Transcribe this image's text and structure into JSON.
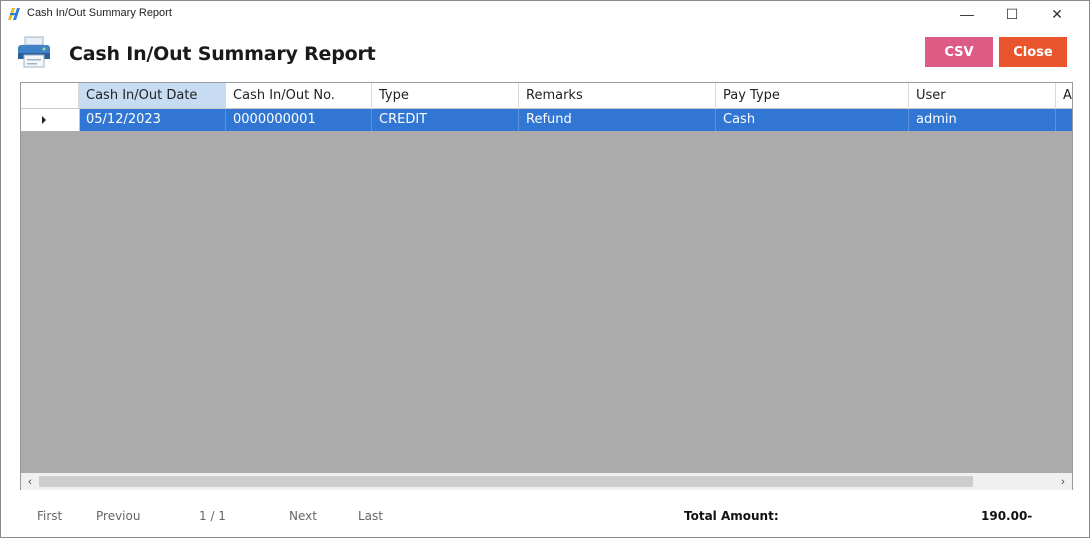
{
  "window": {
    "title": "Cash In/Out Summary Report",
    "controls": {
      "minimize": "—",
      "maximize": "☐",
      "close": "✕"
    }
  },
  "header": {
    "title": "Cash In/Out Summary Report",
    "csv_label": "CSV",
    "close_label": "Close",
    "colors": {
      "csv": "#dc5c85",
      "close": "#e8552c",
      "selection": "#3176d2"
    }
  },
  "grid": {
    "columns": [
      "Cash In/Out Date",
      "Cash In/Out No.",
      "Type",
      "Remarks",
      "Pay Type",
      "User",
      "A"
    ],
    "rows": [
      {
        "date": "05/12/2023",
        "number": "0000000001",
        "type": "CREDIT",
        "remarks": "Refund",
        "pay_type": "Cash",
        "user": "admin"
      }
    ]
  },
  "scrollbar": {
    "left": "‹",
    "right": "›"
  },
  "footer": {
    "first": "First",
    "previous": "Previou",
    "page": "1 / 1",
    "next": "Next",
    "last": "Last",
    "total_label": "Total Amount:",
    "total_value": "190.00-"
  }
}
